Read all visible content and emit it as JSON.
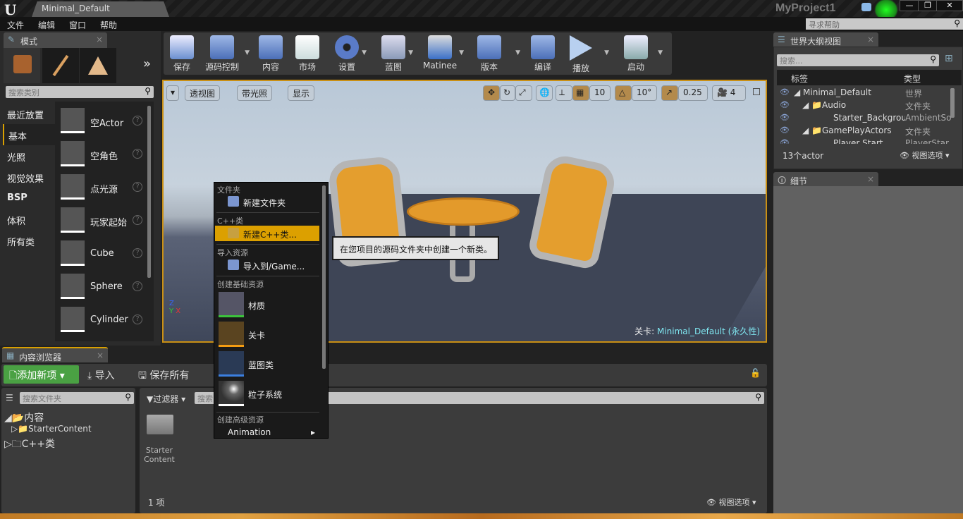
{
  "window": {
    "logo": "U",
    "doc_tab": "Minimal_Default",
    "project": "MyProject1",
    "controls": [
      "—",
      "❐",
      "✕"
    ]
  },
  "menu": [
    "文件",
    "编辑",
    "窗口",
    "帮助"
  ],
  "help_search": {
    "placeholder": "寻求帮助"
  },
  "modes": {
    "tab": "模式",
    "search_placeholder": "搜索类别",
    "categories": [
      "最近放置",
      "基本",
      "光照",
      "视觉效果",
      "BSP",
      "体积",
      "所有类"
    ],
    "selected_category": "基本",
    "items": [
      "空Actor",
      "空角色",
      "点光源",
      "玩家起始",
      "Cube",
      "Sphere",
      "Cylinder"
    ]
  },
  "toolbar": [
    "保存",
    "源码控制",
    "内容",
    "市场",
    "设置",
    "蓝图",
    "Matinee",
    "版本",
    "编译",
    "播放",
    "启动"
  ],
  "viewport": {
    "view_mode": "透视图",
    "lighting": "带光照",
    "show": "显示",
    "grid_snap": "10",
    "rot_snap": "10°",
    "scale_snap": "0.25",
    "camera_speed": "4",
    "level_label": "关卡:",
    "level_name": "Minimal_Default (永久性)"
  },
  "outliner": {
    "tab": "世界大纲视图",
    "search_placeholder": "搜索...",
    "col_label": "标签",
    "col_type": "类型",
    "rows": [
      {
        "label": "Minimal_Default",
        "type": "世界"
      },
      {
        "label": "Audio",
        "type": "文件夹"
      },
      {
        "label": "Starter_Background",
        "type": "AmbientSound"
      },
      {
        "label": "GamePlayActors",
        "type": "文件夹"
      },
      {
        "label": "Player Start",
        "type": "PlayerStart"
      }
    ],
    "count": "13个actor",
    "view_options": "视图选项"
  },
  "details": {
    "tab": "细节"
  },
  "content_browser": {
    "tab": "内容浏览器",
    "add_new": "添加新项",
    "import": "导入",
    "save_all": "保存所有",
    "folder_search_placeholder": "搜索文件夹",
    "tree": [
      {
        "label": "内容"
      },
      {
        "label": "StarterContent"
      },
      {
        "label": "C++类"
      }
    ],
    "filters": "过滤器",
    "asset_search_placeholder": "搜索",
    "assets": [
      "Starter Content"
    ],
    "item_count": "1 项",
    "view_options": "视图选项"
  },
  "context_menu": {
    "sections": [
      "文件夹",
      "C++类",
      "导入资源",
      "创建基础资源",
      "创建高级资源"
    ],
    "new_folder": "新建文件夹",
    "new_cpp": "新建C++类...",
    "import_to": "导入到/Game...",
    "basic": [
      {
        "label": "材质",
        "color": "#3cc23c"
      },
      {
        "label": "关卡",
        "color": "#f39c12"
      },
      {
        "label": "蓝图类",
        "color": "#3b7fe0"
      },
      {
        "label": "粒子系统",
        "color": "#ffffff"
      }
    ],
    "advanced": "Animation"
  },
  "tooltip": "在您项目的源码文件夹中创建一个新类。",
  "colors": {
    "accent": "#d9a000",
    "add_new": "#4aa143",
    "level_name": "#7fe6f0"
  }
}
